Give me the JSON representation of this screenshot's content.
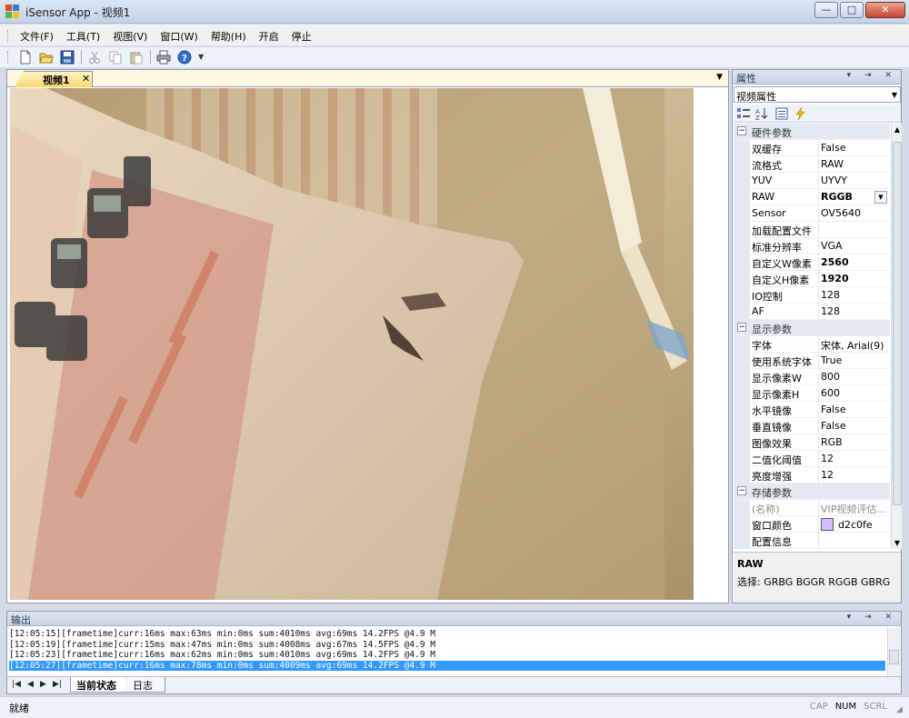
{
  "window": {
    "title": "iSensor App - 视频1",
    "minimize_glyph": "—",
    "maximize_glyph": "□",
    "close_glyph": "✕"
  },
  "menu": {
    "items": [
      "文件(F)",
      "工具(T)",
      "视图(V)",
      "窗口(W)",
      "帮助(H)",
      "开启",
      "停止"
    ]
  },
  "toolbar": {
    "icons": [
      "new-file-icon",
      "open-folder-icon",
      "save-icon",
      "cut-icon",
      "copy-icon",
      "paste-icon",
      "print-icon",
      "help-icon"
    ]
  },
  "document": {
    "tab_label": "视频1",
    "tab_close": "✕",
    "tab_menu": "▼"
  },
  "properties": {
    "title": "属性",
    "header_buttons": "▾ ⇥ ✕",
    "object": "视频属性",
    "categories": {
      "hardware": "硬件参数",
      "display": "显示参数",
      "storage": "存储参数"
    },
    "hardware_rows": [
      {
        "name": "双缓存",
        "value": "False"
      },
      {
        "name": "流格式",
        "value": "RAW"
      },
      {
        "name": "YUV",
        "value": "UYVY"
      },
      {
        "name": "RAW",
        "value": "RGGB"
      },
      {
        "name": "Sensor",
        "value": "OV5640"
      },
      {
        "name": "加载配置文件",
        "value": ""
      },
      {
        "name": "标准分辨率",
        "value": "VGA"
      },
      {
        "name": "自定义W像素",
        "value": "2560"
      },
      {
        "name": "自定义H像素",
        "value": "1920"
      },
      {
        "name": "IO控制",
        "value": "128"
      },
      {
        "name": "AF",
        "value": "128"
      }
    ],
    "display_rows": [
      {
        "name": "字体",
        "value": "宋体, Arial(9)"
      },
      {
        "name": "使用系统字体",
        "value": "True"
      },
      {
        "name": "显示像素W",
        "value": "800"
      },
      {
        "name": "显示像素H",
        "value": "600"
      },
      {
        "name": "水平镜像",
        "value": "False"
      },
      {
        "name": "垂直镜像",
        "value": "False"
      },
      {
        "name": "图像效果",
        "value": "RGB"
      },
      {
        "name": "二值化阈值",
        "value": "12"
      },
      {
        "name": "亮度增强",
        "value": "12"
      }
    ],
    "storage_rows": [
      {
        "name": "(名称)",
        "value": "VIP视频评估..."
      },
      {
        "name": "窗口颜色",
        "value": "d2c0fe"
      },
      {
        "name": "配置信息",
        "value": ""
      }
    ],
    "window_color_hex": "#d2c0fe",
    "description": {
      "title": "RAW",
      "text": "选择: GRBG BGGR RGGB GBRG"
    }
  },
  "output": {
    "title": "输出",
    "header_buttons": "▾ ⇥ ✕",
    "lines": [
      "[12:05:15][frametime]curr:16ms max:63ms min:0ms sum:4010ms avg:69ms 14.2FPS @4.9 M",
      "[12:05:19][frametime]curr:15ms max:47ms min:0ms sum:4008ms avg:67ms 14.5FPS @4.9 M",
      "[12:05:23][frametime]curr:16ms max:62ms min:0ms sum:4010ms avg:69ms 14.2FPS @4.9 M",
      "[12:05:27][frametime]curr:16ms max:78ms min:0ms sum:4009ms avg:69ms 14.2FPS @4.9 M"
    ],
    "selected_line": 3,
    "tabs": [
      "当前状态",
      "日志"
    ]
  },
  "status": {
    "text": "就绪",
    "indicators": [
      {
        "label": "CAP",
        "on": false
      },
      {
        "label": "NUM",
        "on": true
      },
      {
        "label": "SCRL",
        "on": false
      }
    ]
  }
}
